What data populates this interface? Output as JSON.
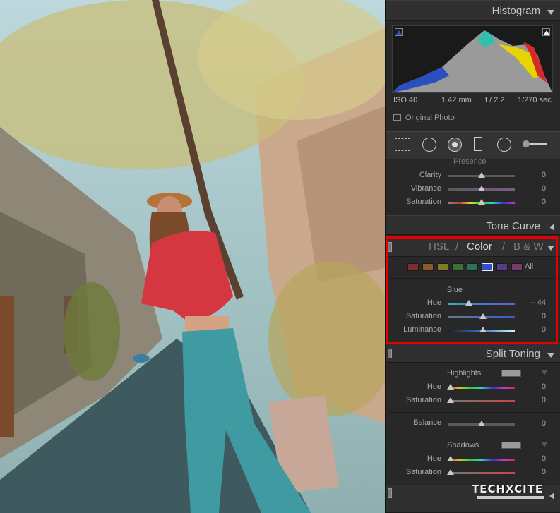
{
  "histogram": {
    "title": "Histogram",
    "iso": "ISO 40",
    "focal": "1.42 mm",
    "aperture": "f / 2.2",
    "shutter": "1/270 sec",
    "original_photo": "Original Photo"
  },
  "presence": {
    "title": "Presence",
    "rows": [
      {
        "label": "Clarity",
        "value": "0"
      },
      {
        "label": "Vibrance",
        "value": "0"
      },
      {
        "label": "Saturation",
        "value": "0"
      }
    ]
  },
  "tone_curve": {
    "title": "Tone Curve"
  },
  "hsl": {
    "tab_hsl": "HSL",
    "sep1": "/",
    "tab_color": "Color",
    "sep2": "/",
    "tab_bw": "B & W",
    "all_label": "All",
    "swatch_colors": [
      "#7a2e2e",
      "#8a5a2a",
      "#807a2a",
      "#3f6f35",
      "#2f6f60",
      "#2f4fcf",
      "#5a3a8a",
      "#7a3a6a"
    ],
    "selected_color": "Blue",
    "rows": [
      {
        "label": "Hue",
        "value": "– 44"
      },
      {
        "label": "Saturation",
        "value": "0"
      },
      {
        "label": "Luminance",
        "value": "0"
      }
    ]
  },
  "split_toning": {
    "title": "Split Toning",
    "highlights_label": "Highlights",
    "balance_label": "Balance",
    "balance_value": "0",
    "shadows_label": "Shadows",
    "highlights_rows": [
      {
        "label": "Hue",
        "value": "0"
      },
      {
        "label": "Saturation",
        "value": "0"
      }
    ],
    "shadows_rows": [
      {
        "label": "Hue",
        "value": "0"
      },
      {
        "label": "Saturation",
        "value": "0"
      }
    ]
  },
  "watermark": {
    "brand": "TECHXCITE"
  },
  "colors": {
    "highlight_box": "#e60000",
    "accent_selected_swatch": "#2f4fcf"
  }
}
